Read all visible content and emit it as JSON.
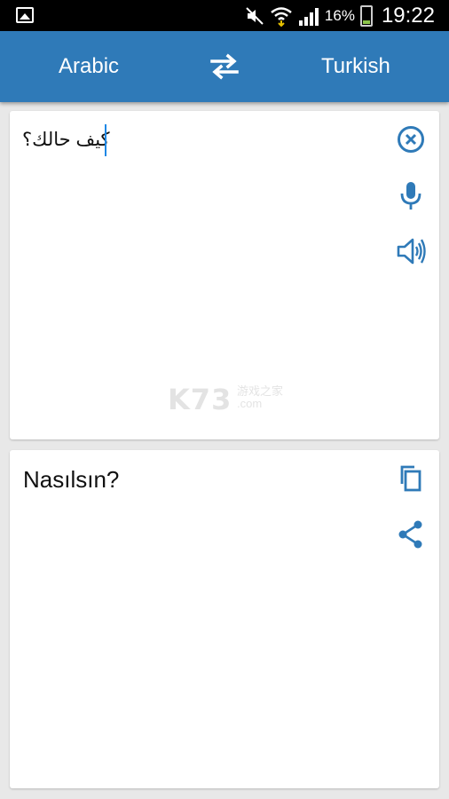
{
  "status_bar": {
    "battery_percent": "16%",
    "time": "19:22",
    "icons": [
      "gallery-icon",
      "mute-icon",
      "wifi-icon",
      "signal-icon",
      "battery-icon"
    ]
  },
  "toolbar": {
    "source_language": "Arabic",
    "target_language": "Turkish",
    "swap_icon": "swap-arrows-icon"
  },
  "input_card": {
    "text": "كيف حالك؟",
    "actions": [
      "clear-icon",
      "microphone-icon",
      "speaker-icon"
    ]
  },
  "output_card": {
    "text": "Nasılsın?",
    "actions": [
      "copy-icon",
      "share-icon"
    ]
  },
  "watermark": {
    "main": "K73",
    "sub1": "游戏之家",
    "sub2": ".com"
  },
  "colors": {
    "app_bar": "#2f7ab8",
    "icon_blue": "#2f7ab8",
    "cursor": "#1e88e5",
    "background": "#e8e8e8"
  }
}
